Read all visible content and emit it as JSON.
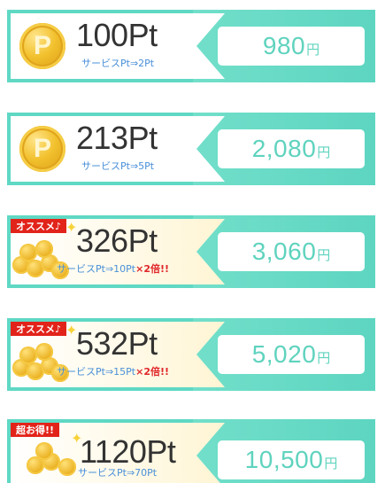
{
  "items": [
    {
      "points": "100Pt",
      "service": "サービスPt⇒2Pt",
      "bonus": "",
      "price": "980",
      "unit": "円",
      "badge": "",
      "coin_letter": "P"
    },
    {
      "points": "213Pt",
      "service": "サービスPt⇒5Pt",
      "bonus": "",
      "price": "2,080",
      "unit": "円",
      "badge": "",
      "coin_letter": "P"
    },
    {
      "points": "326Pt",
      "service": "サービスPt⇒10Pt",
      "bonus": "×2倍!!",
      "price": "3,060",
      "unit": "円",
      "badge": "オススメ♪"
    },
    {
      "points": "532Pt",
      "service": "サービスPt⇒15Pt",
      "bonus": "×2倍!!",
      "price": "5,020",
      "unit": "円",
      "badge": "オススメ♪"
    },
    {
      "points": "1120Pt",
      "service": "サービスPt⇒70Pt",
      "bonus": "",
      "price": "10,500",
      "unit": "円",
      "badge": "超お得!!"
    }
  ],
  "colors": {
    "teal": "#5fd8c4",
    "price_text": "#5fd3be",
    "service_text": "#4a90d8",
    "bonus_text": "#e0262a",
    "badge_bg": "#e2231a"
  }
}
